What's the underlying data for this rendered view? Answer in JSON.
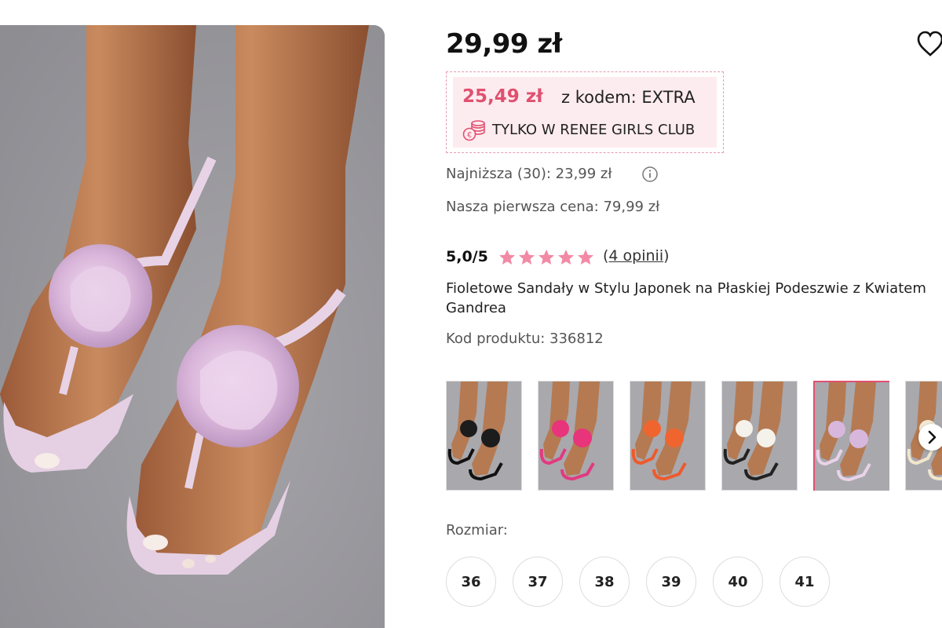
{
  "product": {
    "price": "29,99 zł",
    "promo": {
      "price": "25,49 zł",
      "code_text": "z kodem: EXTRA",
      "club_text": "TYLKO W RENEE GIRLS CLUB"
    },
    "lowest_price": "Najniższa (30): 23,99 zł",
    "first_price": "Nasza pierwsza cena: 79,99 zł",
    "rating": {
      "value": "5,0/5",
      "stars": 5,
      "reviews_link": "4 opinii"
    },
    "title": "Fioletowe Sandały w Stylu Japonek na Płaskiej Podeszwie z Kwiatem Gandrea",
    "product_code": "Kod produktu: 336812",
    "variants": [
      {
        "color": "#1c1c1c",
        "strap": "#111111",
        "selected": false
      },
      {
        "color": "#e8347a",
        "strap": "#e23a7f",
        "selected": false
      },
      {
        "color": "#f0652f",
        "strap": "#ee5a2c",
        "selected": false
      },
      {
        "color": "#f4f2ea",
        "strap": "#222222",
        "selected": false
      },
      {
        "color": "#d8b7dd",
        "strap": "#e9d3e8",
        "selected": true
      },
      {
        "color": "#f3ead6",
        "strap": "#f1e6cc",
        "selected": false
      }
    ],
    "size_label": "Rozmiar:",
    "sizes": [
      "36",
      "37",
      "38",
      "39",
      "40",
      "41"
    ]
  },
  "icons": {
    "favorite": "heart-icon",
    "info": "info-icon",
    "club": "coins-icon",
    "star": "star-icon",
    "next": "chevron-right-icon"
  },
  "colors": {
    "accent": "#e0506f",
    "star": "#f28aa5",
    "promo_bg": "#fdecef"
  }
}
